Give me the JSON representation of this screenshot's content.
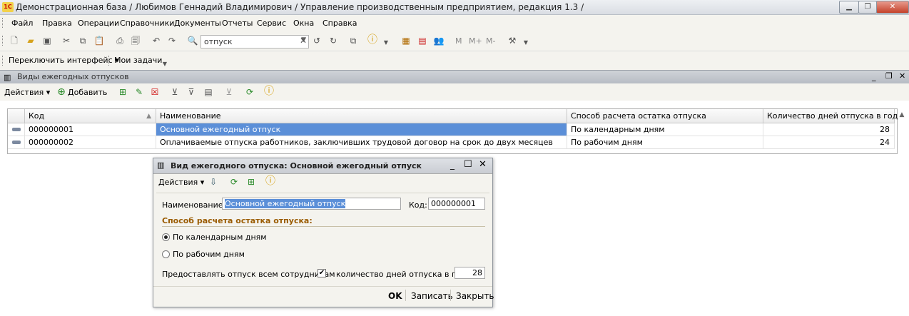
{
  "window": {
    "title": "Демонстрационная база / Любимов Геннадий Владимирович / Управление производственным предприятием, редакция 1.3 /",
    "app_icon": "1С",
    "controls": [
      "minimize-icon",
      "restore-icon",
      "close-icon"
    ]
  },
  "menu": {
    "items": [
      "Файл",
      "Правка",
      "Операции",
      "Справочники",
      "Документы",
      "Отчеты",
      "Сервис",
      "Окна",
      "Справка"
    ]
  },
  "toolbar": {
    "search_value": "отпуск",
    "memory_buttons": [
      "M",
      "M+",
      "M-"
    ]
  },
  "toolbar2": {
    "switch_interface": "Переключить интерфейс",
    "my_tasks": "Мои задачи"
  },
  "list_window": {
    "title": "Виды ежегодных отпусков",
    "actions_label": "Действия",
    "add_label": "Добавить",
    "columns": [
      "Код",
      "Наименование",
      "Способ расчета остатка отпуска",
      "Количество дней отпуска в год"
    ],
    "rows": [
      {
        "code": "000000001",
        "name": "Основной ежегодный отпуск",
        "method": "По календарным дням",
        "days": "28"
      },
      {
        "code": "000000002",
        "name": "Оплачиваемые отпуска работников, заключивших трудовой договор на срок до двух месяцев",
        "method": "По рабочим дням",
        "days": "24"
      }
    ]
  },
  "dialog": {
    "title": "Вид ежегодного отпуска: Основной ежегодный отпуск",
    "actions_label": "Действия",
    "name_label": "Наименование:",
    "name_value": "Основной ежегодный отпуск",
    "code_label": "Код:",
    "code_value": "000000001",
    "method_section": "Способ расчета остатка отпуска:",
    "radio_calendar": "По календарным дням",
    "radio_work": "По рабочим дням",
    "provide_all_label": "Предоставлять отпуск всем сотрудникам",
    "days_label": "количество дней отпуска в год:",
    "days_value": "28",
    "ok_label": "OK",
    "save_label": "Записать",
    "close_label": "Закрыть"
  },
  "colors": {
    "selection": "#5b8fd8",
    "section_header": "#9a5b00"
  }
}
